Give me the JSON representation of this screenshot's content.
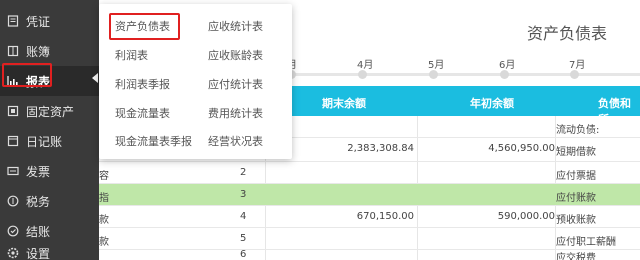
{
  "sidebar": {
    "items": [
      {
        "label": "凭证",
        "icon": "voucher-icon"
      },
      {
        "label": "账簿",
        "icon": "ledger-icon"
      },
      {
        "label": "报表",
        "icon": "chart-icon"
      },
      {
        "label": "固定资产",
        "icon": "fixed-asset-icon"
      },
      {
        "label": "日记账",
        "icon": "journal-icon"
      },
      {
        "label": "发票",
        "icon": "invoice-icon"
      },
      {
        "label": "税务",
        "icon": "tax-icon"
      },
      {
        "label": "结账",
        "icon": "close-books-icon"
      },
      {
        "label": "设置",
        "icon": "settings-icon"
      }
    ],
    "active_index": 2
  },
  "dropdown": {
    "col1": [
      "资产负债表",
      "利润表",
      "利润表季报",
      "现金流量表",
      "现金流量表季报"
    ],
    "col2": [
      "应收统计表",
      "应收账龄表",
      "应付统计表",
      "费用统计表",
      "经营状况表"
    ],
    "highlighted": "资产负债表"
  },
  "page": {
    "title": "资产负债表"
  },
  "timeline": {
    "months": [
      "月",
      "4月",
      "5月",
      "6月",
      "7月"
    ]
  },
  "table": {
    "headers": [
      "期末余额",
      "年初余额",
      "负债和所"
    ],
    "rows": [
      {
        "c0": "",
        "c1": "",
        "c2": "",
        "c3": "",
        "c4": "流动负债:"
      },
      {
        "c0": "",
        "c1": "",
        "c2": "2,383,308.84",
        "c3": "4,560,950.00",
        "c4": "短期借款"
      },
      {
        "c0": "容",
        "c1": "2",
        "c2": "",
        "c3": "",
        "c4": "应付票据"
      },
      {
        "c0": "指",
        "c1": "3",
        "c2": "",
        "c3": "",
        "c4": "应付账款"
      },
      {
        "c0": "款",
        "c1": "4",
        "c2": "670,150.00",
        "c3": "590,000.00",
        "c4": "预收账款"
      },
      {
        "c0": "款",
        "c1": "5",
        "c2": "",
        "c3": "",
        "c4": "应付职工薪酬"
      },
      {
        "c0": "",
        "c1": "6",
        "c2": "",
        "c3": "",
        "c4": "应交税费"
      }
    ]
  },
  "colors": {
    "sidebar_bg": "#3a3a3a",
    "header_bg": "#1bbde0",
    "highlight_row": "#bfe7a8",
    "annotation_red": "#e02020"
  }
}
